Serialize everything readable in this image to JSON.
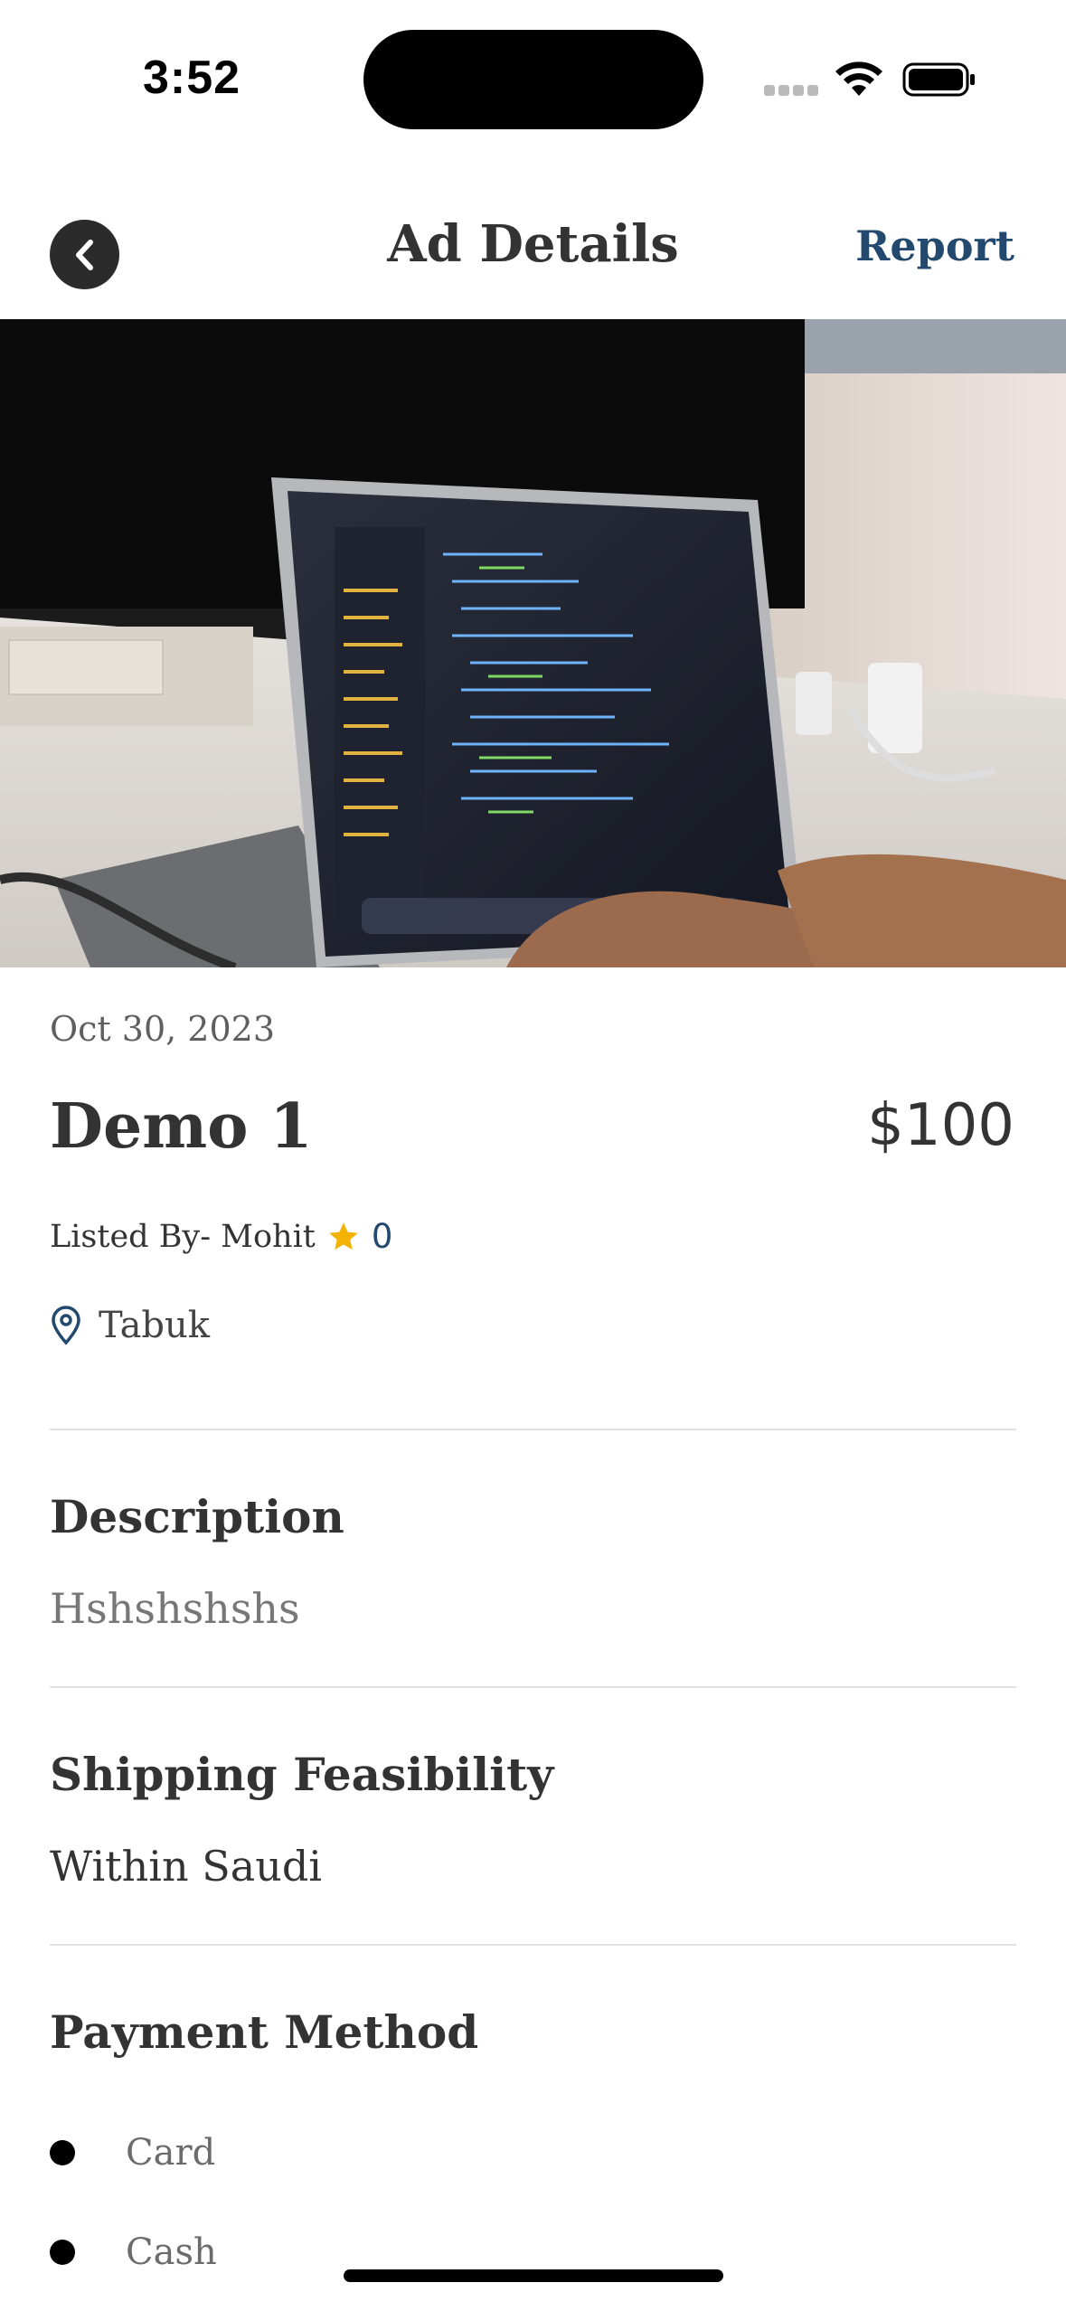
{
  "status_bar": {
    "time": "3:52"
  },
  "header": {
    "title": "Ad Details",
    "report_label": "Report"
  },
  "ad": {
    "date": "Oct 30, 2023",
    "title": "Demo 1",
    "price": "$100",
    "listed_by": "Listed By- Mohit",
    "rating": "0",
    "location": "Tabuk"
  },
  "description": {
    "heading": "Description",
    "text": "Hshshshshs"
  },
  "shipping": {
    "heading": "Shipping Feasibility",
    "text": "Within Saudi"
  },
  "payment": {
    "heading": "Payment Method",
    "methods": [
      "Card",
      "Cash"
    ]
  },
  "colors": {
    "accent": "#23496e",
    "text": "#333333",
    "muted": "#6b6b6b",
    "star": "#f5b301"
  },
  "icons": [
    "back-arrow-icon",
    "star-icon",
    "location-pin-icon",
    "wifi-icon",
    "battery-icon"
  ]
}
